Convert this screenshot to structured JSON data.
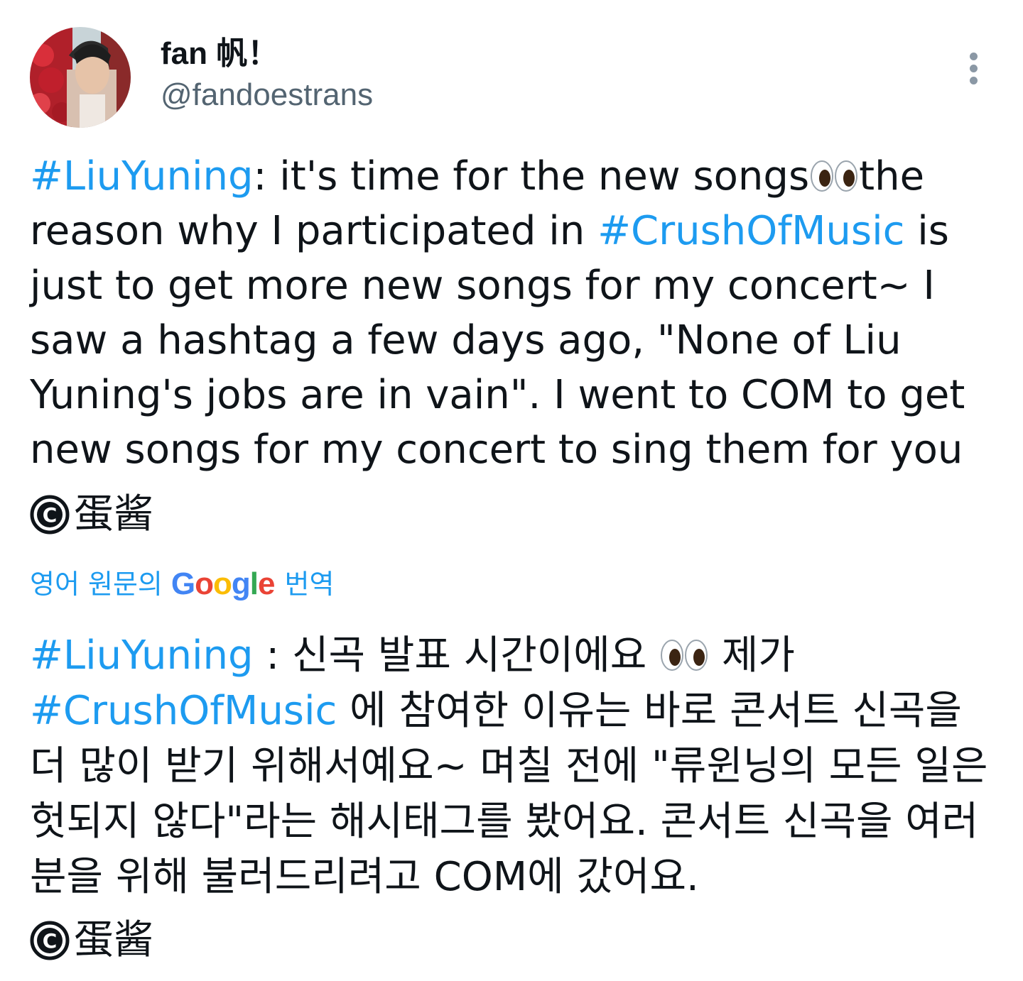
{
  "author": {
    "display_name": "fan 帆！",
    "handle": "@fandoestrans"
  },
  "tweet": {
    "hashtag_1": "#LiuYuning",
    "text_1": ": it's time for the new songs",
    "eyes_emoji": "👀",
    "text_2": "the reason why I participated in ",
    "hashtag_2": "#CrushOfMusic",
    "text_3": " is just to get more new songs for my concert~ I saw a hashtag a few days ago, \"None of Liu Yuning's jobs are in vain\". I went to COM to get new songs for my concert to sing them for you",
    "credit": "蛋酱"
  },
  "translation_link": {
    "prefix": "영어 원문의",
    "google": "Google",
    "suffix": "번역"
  },
  "translation": {
    "hashtag_1": "#LiuYuning",
    "text_1": " : 신곡 발표 시간이에요 ",
    "eyes_emoji": "👀",
    "text_2": " 제가 ",
    "hashtag_2": "#CrushOfMusic",
    "text_3": " 에 참여한 이유는 바로 콘서트 신곡을 더 많이 받기 위해서예요~ 며칠 전에 \"류윈닝의 모든 일은 헛되지 않다\"라는 해시태그를 봤어요. 콘서트 신곡을 여러분을 위해 불러드리려고 COM에 갔어요.",
    "credit": "蛋酱"
  },
  "icons": {
    "more": "more-vertical-icon",
    "copyright": "copyright-icon",
    "eyes": "eyes-emoji"
  },
  "colors": {
    "hashtag": "#1d9bf0",
    "text": "#0f1419",
    "secondary": "#536471",
    "google_blue": "#4285F4",
    "google_red": "#EA4335",
    "google_yellow": "#FBBC05",
    "google_green": "#34A853"
  }
}
